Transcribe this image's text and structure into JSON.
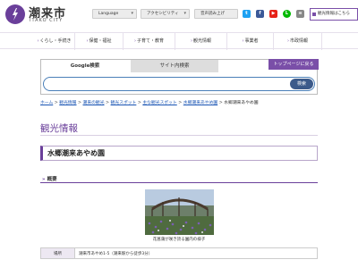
{
  "header": {
    "logo_title": "潮来市",
    "logo_sub": "ITAKO CITY",
    "language_label": "Language",
    "accessibility_label": "アクセシビリティ",
    "voice_label": "音声読み上げ",
    "tourism_label": "観光情報はこちら",
    "sns": [
      "twitter-icon",
      "facebook-icon",
      "youtube-icon",
      "line-icon",
      "share-icon"
    ]
  },
  "nav": {
    "items": [
      {
        "label": "くらし・手続き"
      },
      {
        "label": "保健・福祉"
      },
      {
        "label": "子育て・教育"
      },
      {
        "label": "観光情報"
      },
      {
        "label": "事業者"
      },
      {
        "label": "市政情報"
      }
    ]
  },
  "search": {
    "tab_google": "Google検索",
    "tab_site": "サイト内検索",
    "placeholder": "",
    "button_label": "検索",
    "top_back_label": "トップページに戻る"
  },
  "breadcrumb": {
    "items": [
      "ホーム",
      "観光情報",
      "潮来の観光",
      "観光スポット",
      "主な観光スポット",
      "水郷潮来あやめ園"
    ],
    "current": "水郷潮来あやめ園"
  },
  "content": {
    "section_title": "観光情報",
    "page_title": "水郷潮来あやめ園",
    "overview_heading": "概要",
    "photo_caption": "花菖蒲が咲き誇る園内の様子",
    "table": {
      "place_label": "場所",
      "place_value": "潮来市あやめ1-5（潮来駅から徒歩3分）"
    }
  },
  "colors": {
    "brand_purple": "#6a3f9a",
    "link_blue": "#1a55b4",
    "search_blue": "#3c5a8a"
  }
}
